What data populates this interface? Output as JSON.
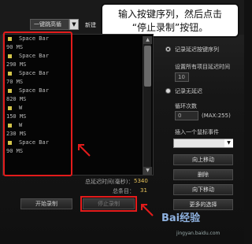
{
  "topbar": {
    "mode_select_value": "一键跳高循",
    "new_button_label": "新建"
  },
  "callout": {
    "line1": "输入按键序列，然后点击",
    "line2": "“停止录制”按钮。"
  },
  "sequence": [
    {
      "type": "key",
      "text": "Space Bar"
    },
    {
      "type": "delay",
      "text": "90 MS"
    },
    {
      "type": "key",
      "text": "Space Bar"
    },
    {
      "type": "delay",
      "text": "290 MS"
    },
    {
      "type": "key",
      "text": "Space Bar"
    },
    {
      "type": "delay",
      "text": "70 MS"
    },
    {
      "type": "key",
      "text": "Space Bar"
    },
    {
      "type": "delay",
      "text": "820 MS"
    },
    {
      "type": "key",
      "text": "W"
    },
    {
      "type": "delay",
      "text": "150 MS"
    },
    {
      "type": "key",
      "text": "W"
    },
    {
      "type": "delay",
      "text": "230 MS"
    },
    {
      "type": "key",
      "text": "Space Bar"
    },
    {
      "type": "delay",
      "text": "90 MS"
    }
  ],
  "stats": {
    "total_delay_label": "总延迟时间(毫秒)：",
    "total_delay_value": "5340",
    "total_items_label": "总条目：",
    "total_items_value": "31"
  },
  "buttons": {
    "start_record": "开始录制",
    "stop_record": "停止录制"
  },
  "panel": {
    "record_delay_label": "记录延迟按键序列",
    "set_all_delay_label": "设置所有项目延迟时间",
    "set_all_delay_value": "10",
    "no_delay_label": "记录无延迟",
    "loop_count_label": "循环次数",
    "loop_count_value": "0",
    "loop_count_max": "(MAX:255)",
    "insert_mouse_label": "插入一个鼠标事件",
    "move_up": "向上移动",
    "delete": "删除",
    "move_down": "向下移动",
    "more_options": "更多的选择"
  },
  "watermark": {
    "text": "Bai经验",
    "sub": "jingyan.baidu.com"
  },
  "colors": {
    "highlight": "#e31b1b",
    "value_accent": "#e8c35a",
    "key_marker": "#d4c54a"
  }
}
